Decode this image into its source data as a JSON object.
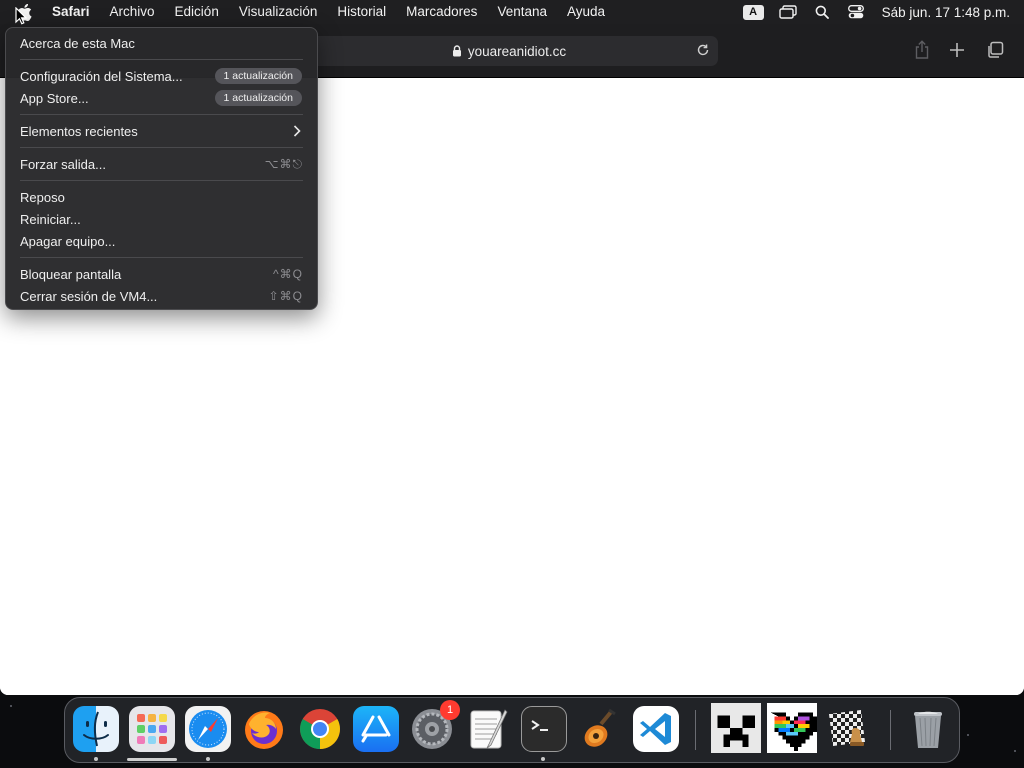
{
  "menubar": {
    "app_name": "Safari",
    "items": [
      "Archivo",
      "Edición",
      "Visualización",
      "Historial",
      "Marcadores",
      "Ventana",
      "Ayuda"
    ],
    "input_source": "A",
    "clock": "Sáb jun. 17  1:48 p.m."
  },
  "browser": {
    "url": "youareanidiot.cc"
  },
  "apple_menu": {
    "about": "Acerca de esta Mac",
    "system_settings": "Configuración del Sistema...",
    "system_settings_badge": "1 actualización",
    "app_store": "App Store...",
    "app_store_badge": "1 actualización",
    "recent_items": "Elementos recientes",
    "force_quit": "Forzar salida...",
    "force_quit_shortcut": "⌥⌘⎋",
    "sleep": "Reposo",
    "restart": "Reiniciar...",
    "shut_down": "Apagar equipo...",
    "lock_screen": "Bloquear pantalla",
    "lock_screen_shortcut": "^⌘Q",
    "log_out": "Cerrar sesión de VM4...",
    "log_out_shortcut": "⇧⌘Q"
  },
  "dock": {
    "apps": [
      "finder-icon",
      "launchpad-icon",
      "safari-icon",
      "firefox-icon",
      "chrome-icon",
      "app-store-icon",
      "system-settings-icon",
      "textedit-icon",
      "terminal-icon",
      "garageband-icon",
      "vscode-icon",
      "minecraft-icon",
      "pixel-heart-icon",
      "chess-icon",
      "trash-icon"
    ],
    "settings_badge": "1"
  },
  "colors": {
    "menubar_bg": "#1f1f21",
    "menu_bg": "#28282a",
    "badge_red": "#ff3b30",
    "vscode_blue": "#1e8ad6"
  }
}
